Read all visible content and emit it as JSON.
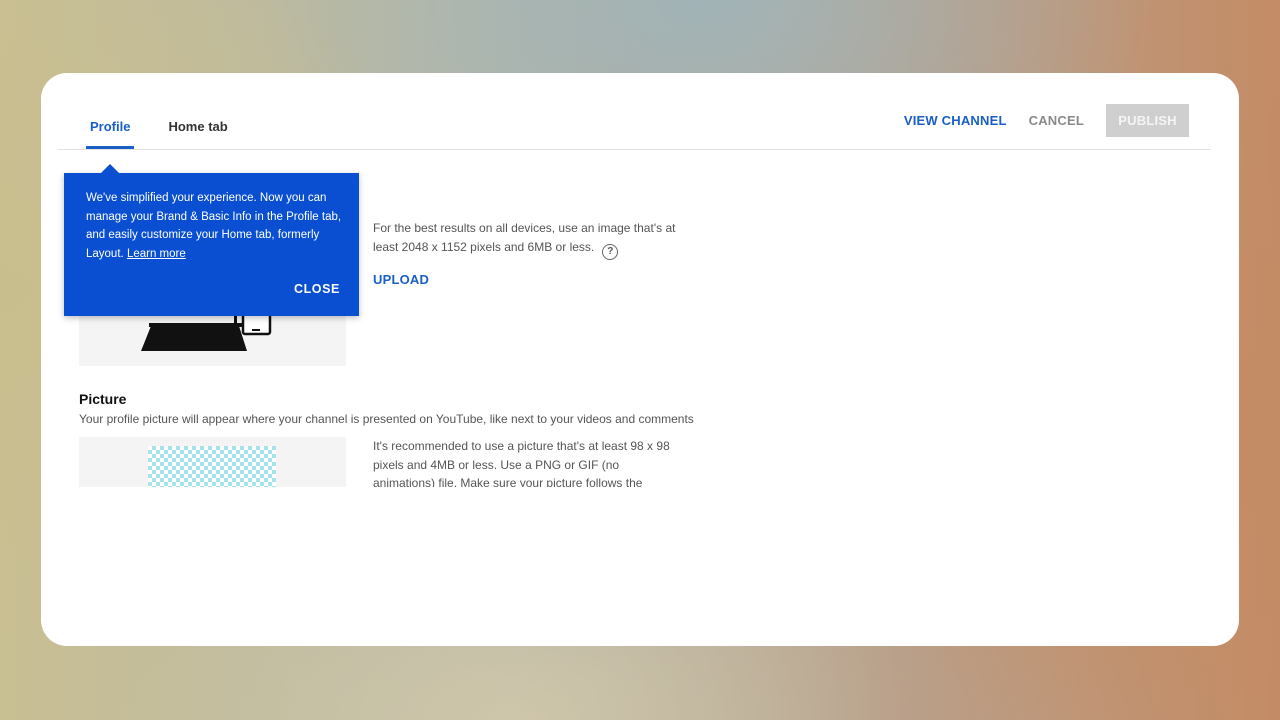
{
  "tabs": [
    {
      "label": "Profile",
      "active": true
    },
    {
      "label": "Home tab",
      "active": false
    }
  ],
  "header": {
    "view_channel": "VIEW CHANNEL",
    "cancel": "CANCEL",
    "publish": "PUBLISH"
  },
  "tooltip": {
    "text": "We've simplified your experience. Now you can manage your Brand & Basic Info in the Profile tab, and easily customize your Home tab, formerly Layout.",
    "link": "Learn more",
    "close": "CLOSE"
  },
  "banner": {
    "description": "For the best results on all devices, use an image that's at least 2048 x 1152 pixels and 6MB or less.",
    "help_icon": "?",
    "upload": "UPLOAD"
  },
  "picture": {
    "title": "Picture",
    "subtitle": "Your profile picture will appear where your channel is presented on YouTube, like next to your videos and comments",
    "description": "It's recommended to use a picture that's at least 98 x 98 pixels and 4MB or less. Use a PNG or GIF (no animations) file. Make sure your picture follows the YouTube"
  },
  "colors": {
    "accent": "#1a5fc7",
    "tooltip_bg": "#0a4fd1",
    "publish_disabled": "#cfcfcf"
  }
}
